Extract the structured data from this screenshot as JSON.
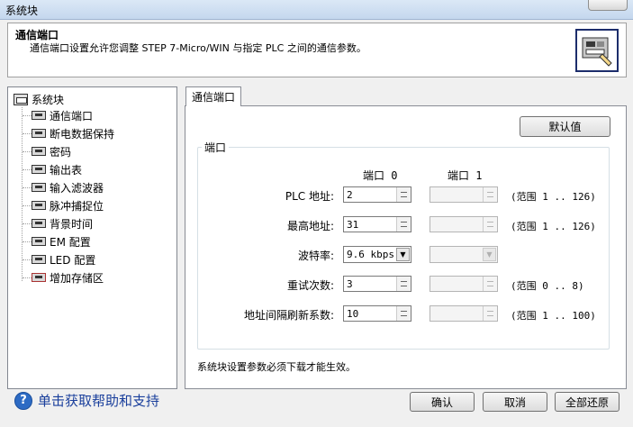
{
  "window": {
    "title": "系统块"
  },
  "header": {
    "title": "通信端口",
    "description": "通信端口设置允许您调整 STEP 7-Micro/WIN 与指定 PLC 之间的通信参数。",
    "icon": "plc-port-icon"
  },
  "tree": {
    "root_label": "系统块",
    "items": [
      {
        "label": "通信端口",
        "icon": "plc-node-icon"
      },
      {
        "label": "断电数据保持",
        "icon": "plc-node-icon"
      },
      {
        "label": "密码",
        "icon": "plc-node-icon"
      },
      {
        "label": "输出表",
        "icon": "plc-node-icon"
      },
      {
        "label": "输入滤波器",
        "icon": "plc-node-icon"
      },
      {
        "label": "脉冲捕捉位",
        "icon": "plc-node-icon"
      },
      {
        "label": "背景时间",
        "icon": "plc-node-icon"
      },
      {
        "label": "EM 配置",
        "icon": "plc-node-icon"
      },
      {
        "label": "LED 配置",
        "icon": "plc-node-icon"
      },
      {
        "label": "增加存储区",
        "icon": "plc-node-x-icon"
      }
    ]
  },
  "tab": {
    "label": "通信端口"
  },
  "defaults_button": "默认值",
  "port_group": {
    "title": "端口",
    "col0": "端口 0",
    "col1": "端口 1",
    "rows": [
      {
        "label": "PLC 地址:",
        "port0": "2",
        "range": "(范围 1 .. 126)"
      },
      {
        "label": "最高地址:",
        "port0": "31",
        "range": "(范围 1 .. 126)"
      },
      {
        "label": "波特率:",
        "port0": "9.6 kbps",
        "range": ""
      },
      {
        "label": "重试次数:",
        "port0": "3",
        "range": "(范围 0 .. 8)"
      },
      {
        "label": "地址间隔刷新系数:",
        "port0": "10",
        "range": "(范围 1 .. 100)"
      }
    ]
  },
  "note": "系统块设置参数必须下载才能生效。",
  "footer": {
    "help_text": "单击获取帮助和支持",
    "ok": "确认",
    "cancel": "取消",
    "restore_all": "全部还原"
  },
  "colors": {
    "title_bar": "#c4d7ee",
    "help_link": "#1a3f9c",
    "header_icon_border": "#1c2d6b"
  }
}
